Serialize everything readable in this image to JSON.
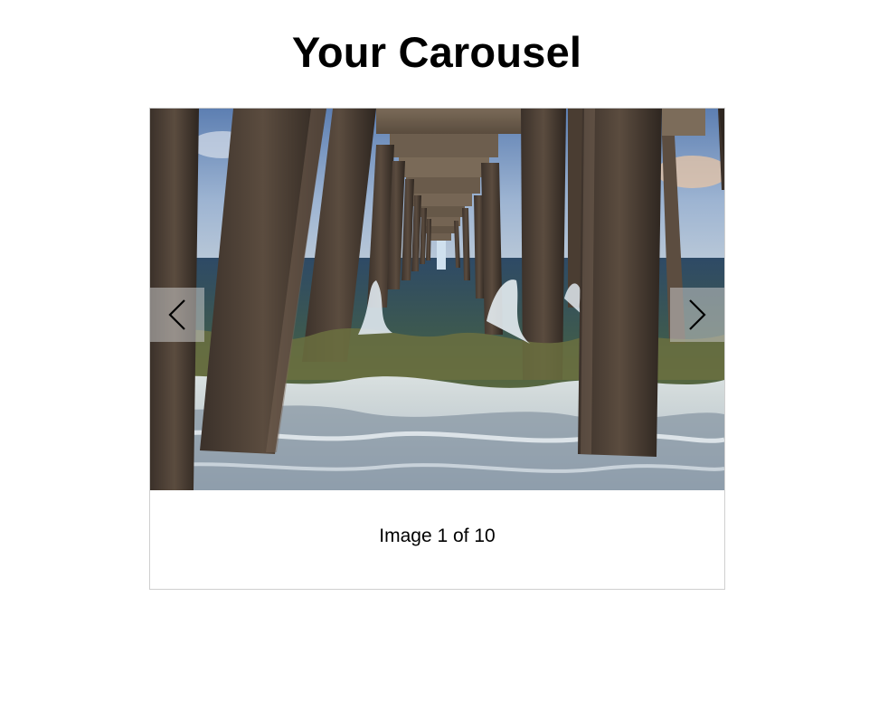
{
  "page": {
    "title": "Your Carousel"
  },
  "carousel": {
    "current_index": 1,
    "total": 10,
    "caption": "Image 1 of 10",
    "prev_icon": "chevron-left-icon",
    "next_icon": "chevron-right-icon",
    "nav_button_color": "#c8c8c8",
    "image_subject": "pier-pilings-over-ocean-waves"
  }
}
